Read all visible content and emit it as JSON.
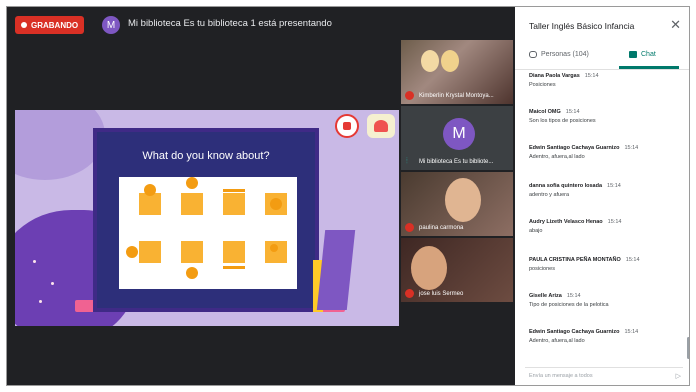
{
  "recording": {
    "label": "GRABANDO"
  },
  "presenter": {
    "avatar_letter": "M",
    "text": "Mi biblioteca Es tu biblioteca 1 está presentando"
  },
  "slide": {
    "title": "What do you know about?"
  },
  "participants": [
    {
      "name": "Kimberlin Krystal Montoya..."
    },
    {
      "name": "Mi biblioteca Es tu bibliote...",
      "avatar_letter": "M"
    },
    {
      "name": "paulina carmona"
    },
    {
      "name": "jose luis Sermeo"
    }
  ],
  "panel": {
    "title": "Taller Inglés Básico Infancia",
    "tab_people": "Personas (104)",
    "tab_chat": "Chat",
    "input_placeholder": "Envía un mensaje a todos"
  },
  "messages": [
    {
      "sender": "Diana Paola Vargas",
      "time": "15:14",
      "text": "Posiciones"
    },
    {
      "sender": "Maicol OMG",
      "time": "15:14",
      "text": "Son los tipos de posiciones"
    },
    {
      "sender": "Edwin Santiago Cachaya Guarnizo",
      "time": "15:14",
      "text": "Adentro, afuera,al lado"
    },
    {
      "sender": "danna sofia quintero losada",
      "time": "15:14",
      "text": "adentro y afuera"
    },
    {
      "sender": "Audry Lizeth Velasco Henao",
      "time": "15:14",
      "text": "abajo"
    },
    {
      "sender": "PAULA CRISTINA PEÑA MONTAÑO",
      "time": "15:14",
      "text": "posiciones"
    },
    {
      "sender": "Giselle Ariza",
      "time": "15:14",
      "text": "Tipo de posiciones de la pelotica"
    },
    {
      "sender": "Edwin Santiago Cachaya Guarnizo",
      "time": "15:14",
      "text": "Adentro, afuera,al lado"
    }
  ]
}
